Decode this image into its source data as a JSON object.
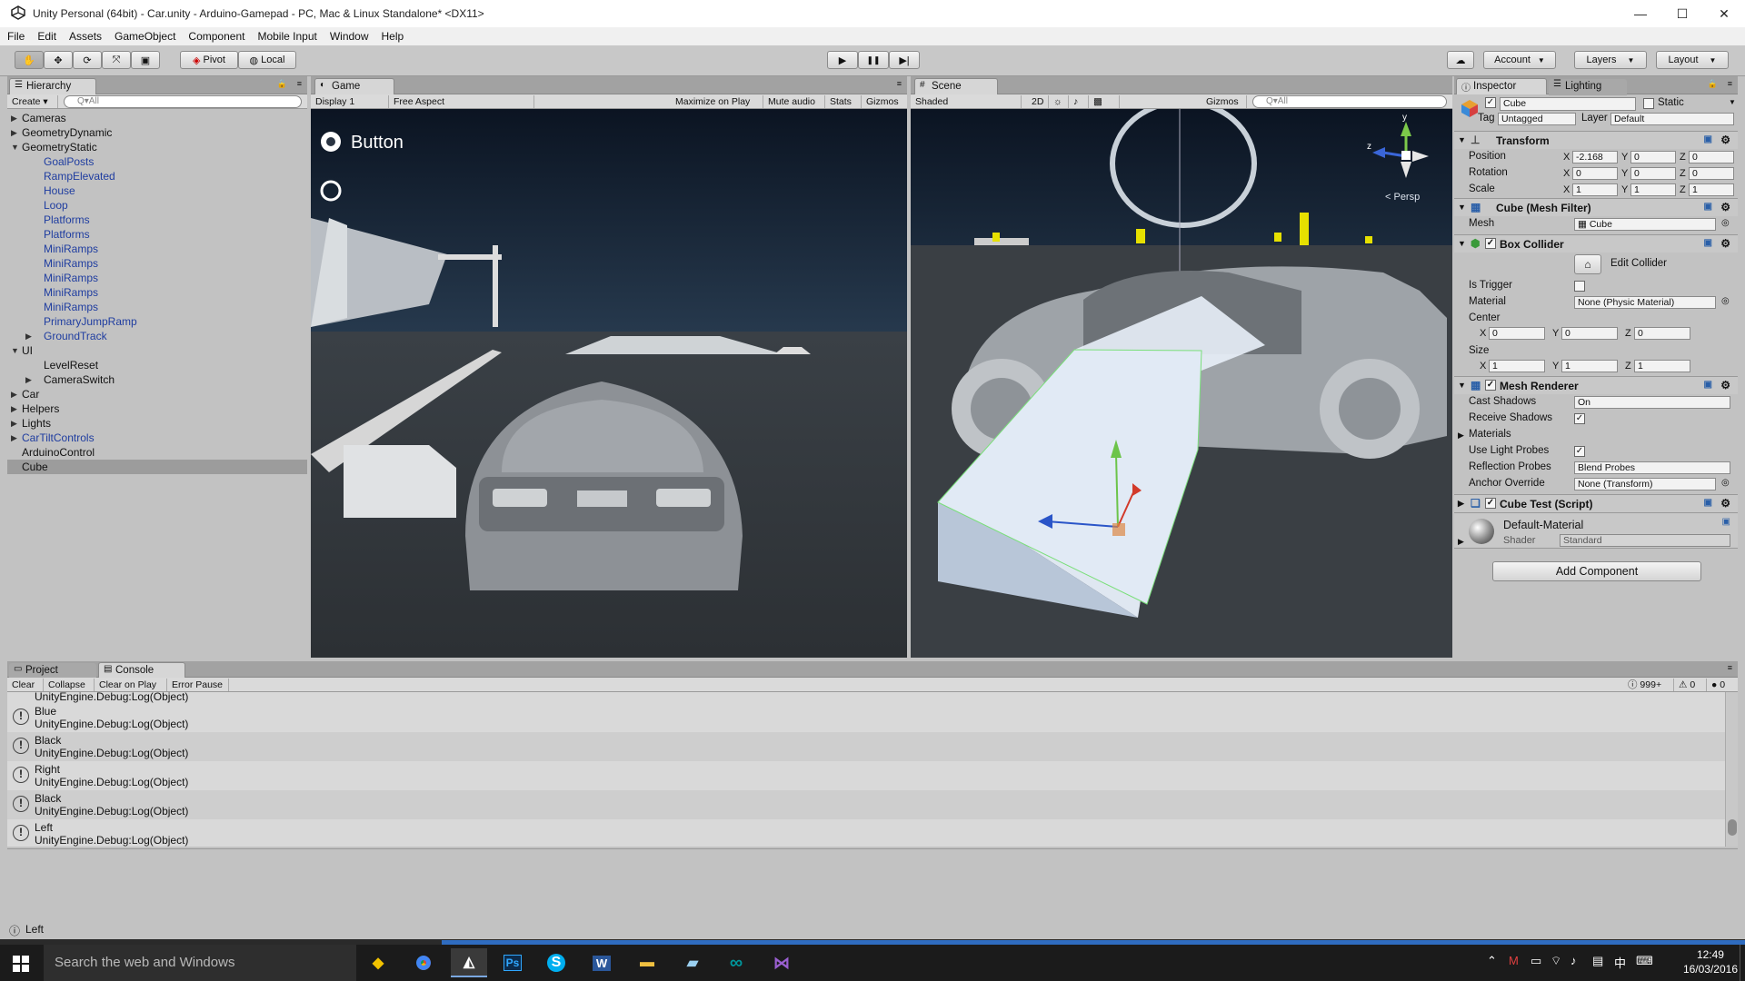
{
  "window": {
    "title": "Unity Personal (64bit) - Car.unity - Arduino-Gamepad - PC, Mac & Linux Standalone* <DX11>",
    "min": "—",
    "max": "☐",
    "close": "✕"
  },
  "menu": [
    "File",
    "Edit",
    "Assets",
    "GameObject",
    "Component",
    "Mobile Input",
    "Window",
    "Help"
  ],
  "toolbar": {
    "pivot": "Pivot",
    "local": "Local",
    "play": "▶",
    "pause": "❚❚",
    "step": "▶|",
    "account": "Account",
    "layers": "Layers",
    "layout": "Layout"
  },
  "hierarchy": {
    "tab": "Hierarchy",
    "create": "Create",
    "search_placeholder": "Q▾All",
    "items": [
      {
        "label": "Cameras",
        "arrow": "▶",
        "indent": 0,
        "blue": false
      },
      {
        "label": "GeometryDynamic",
        "arrow": "▶",
        "indent": 0,
        "blue": false
      },
      {
        "label": "GeometryStatic",
        "arrow": "▼",
        "indent": 0,
        "blue": false
      },
      {
        "label": "GoalPosts",
        "arrow": "",
        "indent": 1,
        "blue": true
      },
      {
        "label": "RampElevated",
        "arrow": "",
        "indent": 1,
        "blue": true
      },
      {
        "label": "House",
        "arrow": "",
        "indent": 1,
        "blue": true
      },
      {
        "label": "Loop",
        "arrow": "",
        "indent": 1,
        "blue": true
      },
      {
        "label": "Platforms",
        "arrow": "",
        "indent": 1,
        "blue": true
      },
      {
        "label": "Platforms",
        "arrow": "",
        "indent": 1,
        "blue": true
      },
      {
        "label": "MiniRamps",
        "arrow": "",
        "indent": 1,
        "blue": true
      },
      {
        "label": "MiniRamps",
        "arrow": "",
        "indent": 1,
        "blue": true
      },
      {
        "label": "MiniRamps",
        "arrow": "",
        "indent": 1,
        "blue": true
      },
      {
        "label": "MiniRamps",
        "arrow": "",
        "indent": 1,
        "blue": true
      },
      {
        "label": "MiniRamps",
        "arrow": "",
        "indent": 1,
        "blue": true
      },
      {
        "label": "PrimaryJumpRamp",
        "arrow": "",
        "indent": 1,
        "blue": true
      },
      {
        "label": "GroundTrack",
        "arrow": "▶",
        "indent": 1,
        "blue": true
      },
      {
        "label": "UI",
        "arrow": "▼",
        "indent": 0,
        "blue": false
      },
      {
        "label": "LevelReset",
        "arrow": "",
        "indent": 1,
        "blue": false
      },
      {
        "label": "CameraSwitch",
        "arrow": "▶",
        "indent": 1,
        "blue": false
      },
      {
        "label": "Car",
        "arrow": "▶",
        "indent": 0,
        "blue": false
      },
      {
        "label": "Helpers",
        "arrow": "▶",
        "indent": 0,
        "blue": false
      },
      {
        "label": "Lights",
        "arrow": "▶",
        "indent": 0,
        "blue": false
      },
      {
        "label": "CarTiltControls",
        "arrow": "▶",
        "indent": 0,
        "blue": true
      },
      {
        "label": "ArduinoControl",
        "arrow": "",
        "indent": 0,
        "blue": false
      },
      {
        "label": "Cube",
        "arrow": "",
        "indent": 0,
        "blue": false,
        "selected": true
      }
    ]
  },
  "game": {
    "tab": "Game",
    "display": "Display 1",
    "aspect": "Free Aspect",
    "maximize": "Maximize on Play",
    "mute": "Mute audio",
    "stats": "Stats",
    "gizmos": "Gizmos",
    "overlay_button": "Button"
  },
  "scene": {
    "tab": "Scene",
    "shading": "Shaded",
    "mode2d": "2D",
    "gizmos": "Gizmos",
    "search_placeholder": "Q▾All",
    "persp": "< Persp",
    "axis_y": "y",
    "axis_z": "z"
  },
  "inspector": {
    "tab": "Inspector",
    "tab2": "Lighting",
    "object_name": "Cube",
    "static_label": "Static",
    "tag_label": "Tag",
    "tag_value": "Untagged",
    "layer_label": "Layer",
    "layer_value": "Default",
    "transform": {
      "title": "Transform",
      "position_label": "Position",
      "rotation_label": "Rotation",
      "scale_label": "Scale",
      "position": [
        "-2.168",
        "0",
        "0"
      ],
      "rotation": [
        "0",
        "0",
        "0"
      ],
      "scale": [
        "1",
        "1",
        "1"
      ]
    },
    "mesh_filter": {
      "title": "Cube (Mesh Filter)",
      "mesh_label": "Mesh",
      "mesh_value": "Cube"
    },
    "box_collider": {
      "title": "Box Collider",
      "edit": "Edit Collider",
      "trigger_label": "Is Trigger",
      "material_label": "Material",
      "material_value": "None (Physic Material)",
      "center_label": "Center",
      "center": [
        "0",
        "0",
        "0"
      ],
      "size_label": "Size",
      "size": [
        "1",
        "1",
        "1"
      ]
    },
    "mesh_renderer": {
      "title": "Mesh Renderer",
      "cast_label": "Cast Shadows",
      "cast_value": "On",
      "receive_label": "Receive Shadows",
      "materials_label": "Materials",
      "probes_label": "Use Light Probes",
      "reflection_label": "Reflection Probes",
      "reflection_value": "Blend Probes",
      "anchor_label": "Anchor Override",
      "anchor_value": "None (Transform)"
    },
    "script": {
      "title": "Cube Test (Script)"
    },
    "material": {
      "name": "Default-Material",
      "shader_label": "Shader",
      "shader_value": "Standard"
    },
    "add_component": "Add Component",
    "x": "X",
    "y": "Y",
    "z": "Z"
  },
  "console": {
    "tab_project": "Project",
    "tab_console": "Console",
    "clear": "Clear",
    "collapse": "Collapse",
    "clear_on_play": "Clear on Play",
    "error_pause": "Error Pause",
    "count_log": "999+",
    "count_warn": "0",
    "count_err": "0",
    "top_partial": "UnityEngine.Debug:Log(Object)",
    "entries": [
      {
        "msg": "Blue",
        "trace": "UnityEngine.Debug:Log(Object)"
      },
      {
        "msg": "Black",
        "trace": "UnityEngine.Debug:Log(Object)"
      },
      {
        "msg": "Right",
        "trace": "UnityEngine.Debug:Log(Object)"
      },
      {
        "msg": "Black",
        "trace": "UnityEngine.Debug:Log(Object)"
      },
      {
        "msg": "Left",
        "trace": "UnityEngine.Debug:Log(Object)"
      }
    ]
  },
  "status": {
    "text": "Left"
  },
  "taskbar": {
    "search": "Search the web and Windows",
    "time": "12:49",
    "date": "16/03/2016",
    "ps": "Ps",
    "w": "W",
    "s": "S",
    "ime": "中"
  }
}
